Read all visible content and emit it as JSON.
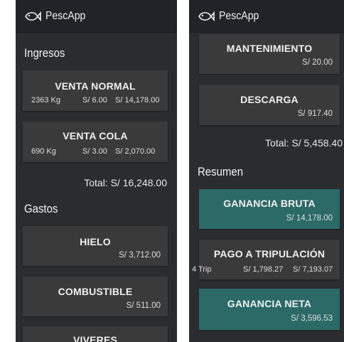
{
  "app": {
    "name": "PescApp"
  },
  "left": {
    "ingresos_title": "Ingresos",
    "ventas": [
      {
        "label": "VENTA NORMAL",
        "qty": "2363 Kg",
        "price": "S/ 6.00",
        "total": "S/ 14,178.00"
      },
      {
        "label": "VENTA COLA",
        "qty": "690 Kg",
        "price": "S/ 3.00",
        "total": "S/ 2,070.00"
      }
    ],
    "ingresos_total": "Total: S/ 16,248.00",
    "gastos_title": "Gastos",
    "gastos": [
      {
        "label": "HIELO",
        "amount": "S/ 3,712.00"
      },
      {
        "label": "COMBUSTIBLE",
        "amount": "S/ 511.00"
      },
      {
        "label": "VIVERES"
      }
    ]
  },
  "right": {
    "gastos": [
      {
        "label": "MANTENIMIENTO",
        "amount": "S/ 20.00"
      },
      {
        "label": "DESCARGA",
        "amount": "S/ 917.40"
      }
    ],
    "gastos_total": "Total: S/ 5,458.40",
    "resumen_title": "Resumen",
    "ganancia_bruta": {
      "label": "GANANCIA BRUTA",
      "amount": "S/ 14,178.00"
    },
    "pago": {
      "label": "PAGO A TRIPULACIÓN",
      "trip": "4 Trip",
      "per": "S/ 1,798.27",
      "total": "S/ 7,193.07"
    },
    "ganancia_neta": {
      "label": "GANANCIA NETA",
      "amount": "S/ 3,596.53"
    }
  },
  "colors": {
    "background": "#2a2c2e",
    "appbar": "#202327",
    "card": "#3a3a3a",
    "accent_card": "#2b6a66"
  }
}
